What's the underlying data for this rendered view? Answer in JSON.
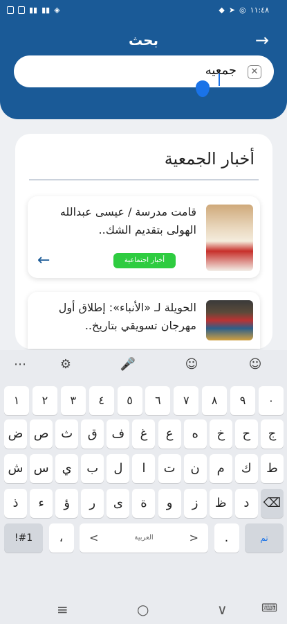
{
  "status": {
    "time": "١١:٤٨",
    "icons_left": [
      "battery-icon",
      "mute-icon",
      "signal-icon",
      "signal-icon",
      "wifi-icon"
    ],
    "icons_right": [
      "shield-icon",
      "telegram-icon",
      "whatsapp-icon"
    ]
  },
  "header": {
    "title": "بحث",
    "back_label": "→"
  },
  "search": {
    "value": "جمعيه",
    "clear": "✕"
  },
  "section": {
    "title": "أخبار الجمعية"
  },
  "news": [
    {
      "text": "قامت مدرسة / عيسى عبدالله الهولى بتقديم الشك..",
      "tag": "أخبار اجتماعية",
      "arrow": "←"
    },
    {
      "text": "الحويلة لـ «الأنباء»: إطلاق أول مهرجان تسويقي بتاريخ..",
      "tag": "",
      "arrow": ""
    }
  ],
  "keyboard": {
    "tools": {
      "more": "⋯",
      "settings": "⚙",
      "mic": "🎤",
      "sticker": "☺",
      "emoji": "☺"
    },
    "row1": [
      "١",
      "٢",
      "٣",
      "٤",
      "٥",
      "٦",
      "٧",
      "٨",
      "٩",
      "٠"
    ],
    "row2": [
      "ض",
      "ص",
      "ث",
      "ق",
      "ف",
      "غ",
      "ع",
      "ه",
      "خ",
      "ح",
      "ج"
    ],
    "row3": [
      "ش",
      "س",
      "ي",
      "ب",
      "ل",
      "ا",
      "ت",
      "ن",
      "م",
      "ك",
      "ط"
    ],
    "row4": [
      "ذ",
      "ء",
      "ؤ",
      "ر",
      "ى",
      "ة",
      "و",
      "ز",
      "ظ",
      "د",
      "⌫"
    ],
    "sym": "!#1",
    "comma": "،",
    "lang": "العربية",
    "dot": ".",
    "enter": "تم",
    "left": "<",
    "right": ">"
  },
  "nav": {
    "recent": "≡",
    "home": "○",
    "back": "∨",
    "kb": "⌨"
  }
}
